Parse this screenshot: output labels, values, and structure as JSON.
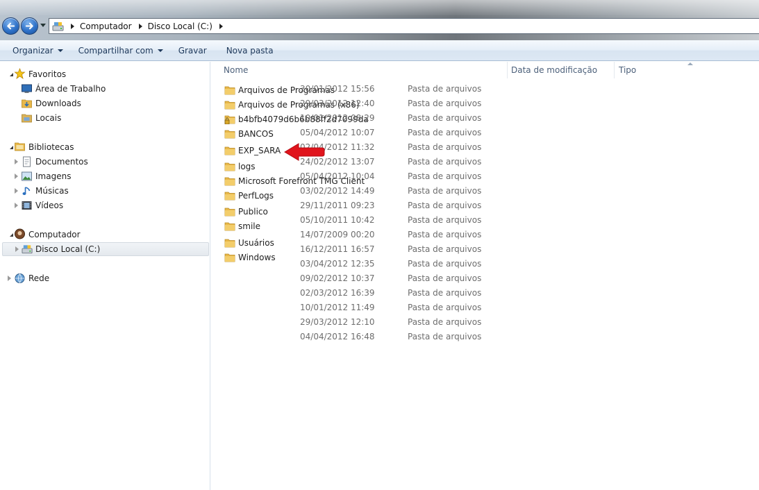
{
  "address": {
    "crumbs": [
      "Computador",
      "Disco Local (C:)"
    ]
  },
  "toolbar": {
    "organize": "Organizar",
    "share": "Compartilhar com",
    "burn": "Gravar",
    "new_folder": "Nova pasta"
  },
  "nav": {
    "favorites": "Favoritos",
    "desktop": "Área de Trabalho",
    "downloads": "Downloads",
    "places": "Locais",
    "libraries": "Bibliotecas",
    "documents": "Documentos",
    "images": "Imagens",
    "music": "Músicas",
    "videos": "Vídeos",
    "computer": "Computador",
    "local_disk": "Disco Local (C:)",
    "network": "Rede"
  },
  "columns": {
    "name": "Nome",
    "modified": "Data de modificação",
    "type": "Tipo"
  },
  "files": [
    {
      "name": "Arquivos de Programas",
      "locked": false
    },
    {
      "name": "Arquivos de Programas (x86)",
      "locked": false
    },
    {
      "name": "b4bfb4079d6b6b88ff2d7099da",
      "locked": true
    },
    {
      "name": "BANCOS",
      "locked": false
    },
    {
      "name": "EXP_SARA",
      "locked": false
    },
    {
      "name": "logs",
      "locked": false
    },
    {
      "name": "Microsoft Forefront TMG Client",
      "locked": false
    },
    {
      "name": "PerfLogs",
      "locked": false
    },
    {
      "name": "Publico",
      "locked": false
    },
    {
      "name": "smile",
      "locked": false
    },
    {
      "name": "Usuários",
      "locked": false
    },
    {
      "name": "Windows",
      "locked": false
    }
  ],
  "details": [
    {
      "date": "30/01/2012 15:56",
      "type": "Pasta de arquivos"
    },
    {
      "date": "29/03/2012 12:40",
      "type": "Pasta de arquivos"
    },
    {
      "date": "10/01/2012 08:29",
      "type": "Pasta de arquivos"
    },
    {
      "date": "05/04/2012 10:07",
      "type": "Pasta de arquivos"
    },
    {
      "date": "02/04/2012 11:32",
      "type": "Pasta de arquivos"
    },
    {
      "date": "24/02/2012 13:07",
      "type": "Pasta de arquivos"
    },
    {
      "date": "05/04/2012 10:04",
      "type": "Pasta de arquivos"
    },
    {
      "date": "03/02/2012 14:49",
      "type": "Pasta de arquivos"
    },
    {
      "date": "29/11/2011 09:23",
      "type": "Pasta de arquivos"
    },
    {
      "date": "05/10/2011 10:42",
      "type": "Pasta de arquivos"
    },
    {
      "date": "14/07/2009 00:20",
      "type": "Pasta de arquivos"
    },
    {
      "date": "16/12/2011 16:57",
      "type": "Pasta de arquivos"
    },
    {
      "date": "03/04/2012 12:35",
      "type": "Pasta de arquivos"
    },
    {
      "date": "09/02/2012 10:37",
      "type": "Pasta de arquivos"
    },
    {
      "date": "02/03/2012 16:39",
      "type": "Pasta de arquivos"
    },
    {
      "date": "10/01/2012 11:49",
      "type": "Pasta de arquivos"
    },
    {
      "date": "29/03/2012 12:10",
      "type": "Pasta de arquivos"
    },
    {
      "date": "04/04/2012 16:48",
      "type": "Pasta de arquivos"
    }
  ],
  "colors": {
    "accent": "#1e395b",
    "arrow": "#e0141c",
    "folder": "#e8b84a"
  },
  "icons": {
    "back": "back-arrow-icon",
    "forward": "forward-arrow-icon",
    "folder": "folder-icon",
    "star": "star-icon",
    "drive": "drive-icon",
    "network": "globe-icon"
  }
}
